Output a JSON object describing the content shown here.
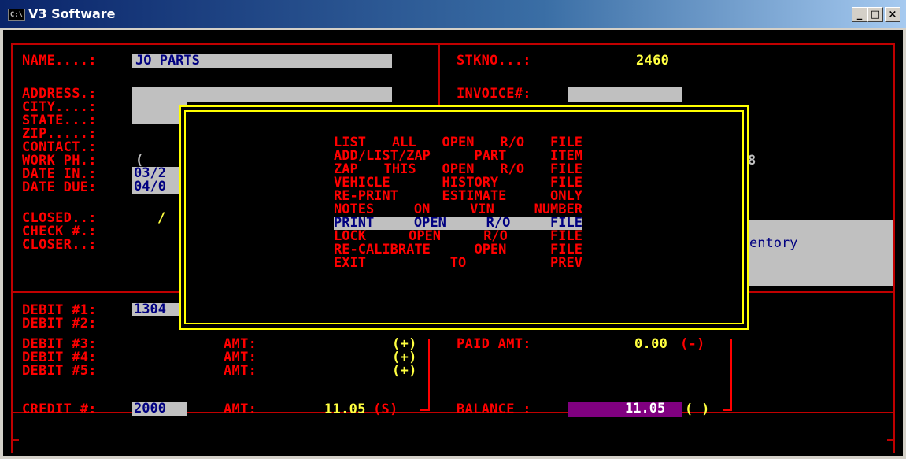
{
  "window": {
    "icon_text": "C:\\",
    "title": "V3 Software",
    "minimize": "_",
    "maximize": "□",
    "close": "×"
  },
  "customer": {
    "name_label": "NAME....:",
    "name_value": "JO PARTS",
    "address_label": "ADDRESS.:",
    "city_label": "CITY....:",
    "state_label": "STATE...:",
    "zip_label": "ZIP.....:",
    "contact_label": "CONTACT.:",
    "workph_label": "WORK PH.:",
    "workph_value": "(",
    "datein_label": "DATE IN.:",
    "datein_value": "03/2",
    "datedue_label": "DATE DUE:",
    "datedue_value": "04/0",
    "closed_label": "CLOSED..:",
    "closed_value": "/",
    "check_label": "CHECK #.:",
    "closer_label": "CLOSER..:"
  },
  "stock": {
    "stkno_label": "STKNO...:",
    "stkno_value": "2460",
    "invoice_label": "INVOICE#:",
    "partial_8": "8",
    "partial_inventory": "entory"
  },
  "debits": {
    "debit1_label": "DEBIT #1:",
    "debit1_value": "1304",
    "debit2_label": "DEBIT #2:",
    "debit3_label": "DEBIT #3:",
    "debit4_label": "DEBIT #4:",
    "debit5_label": "DEBIT #5:",
    "amt_label": "AMT:",
    "plus_sign": "(+)",
    "credit_label": "CREDIT #:",
    "credit_value": "2000",
    "credit_amt": "11.05",
    "credit_sign": "(S)"
  },
  "totals": {
    "paid_label": "PAID AMT:",
    "paid_value": "0.00",
    "paid_sign": "(-)",
    "balance_label": "BALANCE :",
    "balance_value": "11.05",
    "balance_sign": "( )"
  },
  "menu": {
    "items": [
      {
        "label": "LIST ALL OPEN R/O FILE",
        "selected": false
      },
      {
        "label": "ADD/LIST/ZAP PART ITEM",
        "selected": false
      },
      {
        "label": "ZAP THIS OPEN R/O FILE",
        "selected": false
      },
      {
        "label": "VEHICLE HISTORY FILE",
        "selected": false
      },
      {
        "label": "RE-PRINT ESTIMATE ONLY",
        "selected": false
      },
      {
        "label": "NOTES ON VIN NUMBER",
        "selected": false
      },
      {
        "label": "PRINT OPEN R/O FILE",
        "selected": true
      },
      {
        "label": "LOCK OPEN R/O FILE",
        "selected": false
      },
      {
        "label": "RE-CALIBRATE OPEN FILE",
        "selected": false
      },
      {
        "label": "EXIT TO PREV",
        "selected": false
      }
    ]
  },
  "colors": {
    "console_bg": "#000000",
    "label": "#ff0000",
    "value": "#ffff40",
    "field": "#c0c0c0",
    "balance_field": "#800080",
    "dialog_border": "#ffff00"
  }
}
